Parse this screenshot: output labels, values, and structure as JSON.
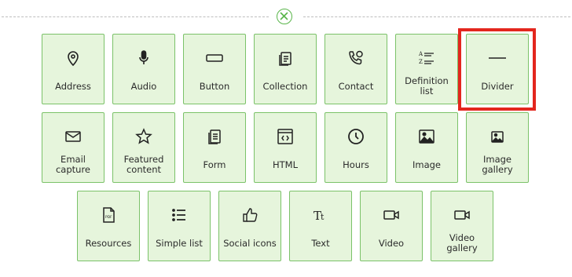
{
  "close_icon": "close-circle-icon",
  "accent_color": "#59b54a",
  "tile_background": "#e6f5dc",
  "selected_tile": "Divider",
  "highlight_color": "#e3261e",
  "tiles": [
    {
      "label": "Address",
      "icon": "map-pin-icon"
    },
    {
      "label": "Audio",
      "icon": "microphone-icon"
    },
    {
      "label": "Button",
      "icon": "button-icon"
    },
    {
      "label": "Collection",
      "icon": "collection-icon"
    },
    {
      "label": "Contact",
      "icon": "phone-chat-icon"
    },
    {
      "label": "Definition list",
      "icon": "definition-list-icon"
    },
    {
      "label": "Divider",
      "icon": "divider-line-icon"
    },
    {
      "label": "Email capture",
      "icon": "envelope-icon"
    },
    {
      "label": "Featured content",
      "icon": "star-icon"
    },
    {
      "label": "Form",
      "icon": "form-icon"
    },
    {
      "label": "HTML",
      "icon": "code-window-icon"
    },
    {
      "label": "Hours",
      "icon": "clock-icon"
    },
    {
      "label": "Image",
      "icon": "image-icon"
    },
    {
      "label": "Image gallery",
      "icon": "image-gallery-icon"
    },
    {
      "label": "Resources",
      "icon": "pdf-file-icon"
    },
    {
      "label": "Simple list",
      "icon": "bullet-list-icon"
    },
    {
      "label": "Social icons",
      "icon": "thumbs-up-icon"
    },
    {
      "label": "Text",
      "icon": "text-tt-icon"
    },
    {
      "label": "Video",
      "icon": "video-camera-icon"
    },
    {
      "label": "Video gallery",
      "icon": "video-gallery-icon"
    }
  ]
}
